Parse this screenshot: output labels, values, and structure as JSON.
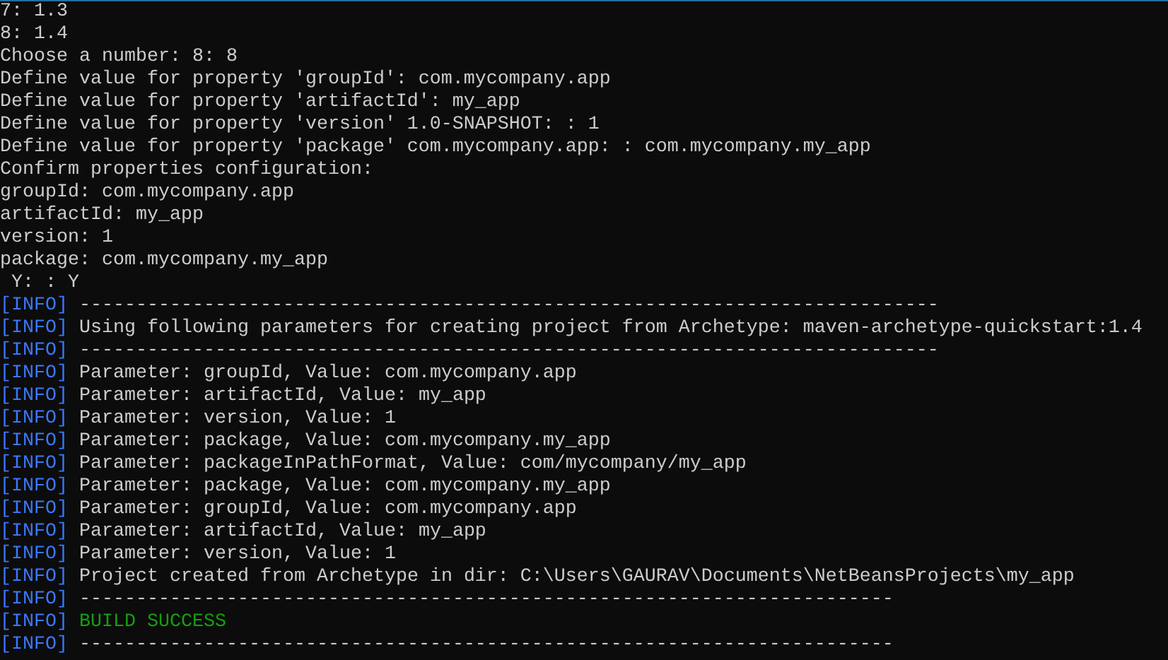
{
  "terminal": {
    "lines": [
      {
        "kind": "plain",
        "text": "7: 1.3"
      },
      {
        "kind": "plain",
        "text": "8: 1.4"
      },
      {
        "kind": "plain",
        "text": "Choose a number: 8: 8"
      },
      {
        "kind": "plain",
        "text": "Define value for property 'groupId': com.mycompany.app"
      },
      {
        "kind": "plain",
        "text": "Define value for property 'artifactId': my_app"
      },
      {
        "kind": "plain",
        "text": "Define value for property 'version' 1.0-SNAPSHOT: : 1"
      },
      {
        "kind": "plain",
        "text": "Define value for property 'package' com.mycompany.app: : com.mycompany.my_app"
      },
      {
        "kind": "plain",
        "text": "Confirm properties configuration:"
      },
      {
        "kind": "plain",
        "text": "groupId: com.mycompany.app"
      },
      {
        "kind": "plain",
        "text": "artifactId: my_app"
      },
      {
        "kind": "plain",
        "text": "version: 1"
      },
      {
        "kind": "plain",
        "text": "package: com.mycompany.my_app"
      },
      {
        "kind": "plain",
        "text": " Y: : Y"
      },
      {
        "kind": "log",
        "tag": "[INFO]",
        "success": false,
        "message": "----------------------------------------------------------------------------"
      },
      {
        "kind": "log",
        "tag": "[INFO]",
        "success": false,
        "message": "Using following parameters for creating project from Archetype: maven-archetype-quickstart:1.4"
      },
      {
        "kind": "log",
        "tag": "[INFO]",
        "success": false,
        "message": "----------------------------------------------------------------------------"
      },
      {
        "kind": "log",
        "tag": "[INFO]",
        "success": false,
        "message": "Parameter: groupId, Value: com.mycompany.app"
      },
      {
        "kind": "log",
        "tag": "[INFO]",
        "success": false,
        "message": "Parameter: artifactId, Value: my_app"
      },
      {
        "kind": "log",
        "tag": "[INFO]",
        "success": false,
        "message": "Parameter: version, Value: 1"
      },
      {
        "kind": "log",
        "tag": "[INFO]",
        "success": false,
        "message": "Parameter: package, Value: com.mycompany.my_app"
      },
      {
        "kind": "log",
        "tag": "[INFO]",
        "success": false,
        "message": "Parameter: packageInPathFormat, Value: com/mycompany/my_app"
      },
      {
        "kind": "log",
        "tag": "[INFO]",
        "success": false,
        "message": "Parameter: package, Value: com.mycompany.my_app"
      },
      {
        "kind": "log",
        "tag": "[INFO]",
        "success": false,
        "message": "Parameter: groupId, Value: com.mycompany.app"
      },
      {
        "kind": "log",
        "tag": "[INFO]",
        "success": false,
        "message": "Parameter: artifactId, Value: my_app"
      },
      {
        "kind": "log",
        "tag": "[INFO]",
        "success": false,
        "message": "Parameter: version, Value: 1"
      },
      {
        "kind": "log",
        "tag": "[INFO]",
        "success": false,
        "message": "Project created from Archetype in dir: C:\\Users\\GAURAV\\Documents\\NetBeansProjects\\my_app"
      },
      {
        "kind": "log",
        "tag": "[INFO]",
        "success": false,
        "message": "------------------------------------------------------------------------"
      },
      {
        "kind": "log",
        "tag": "[INFO]",
        "success": true,
        "message": "BUILD SUCCESS"
      },
      {
        "kind": "log",
        "tag": "[INFO]",
        "success": false,
        "message": "------------------------------------------------------------------------"
      }
    ]
  }
}
